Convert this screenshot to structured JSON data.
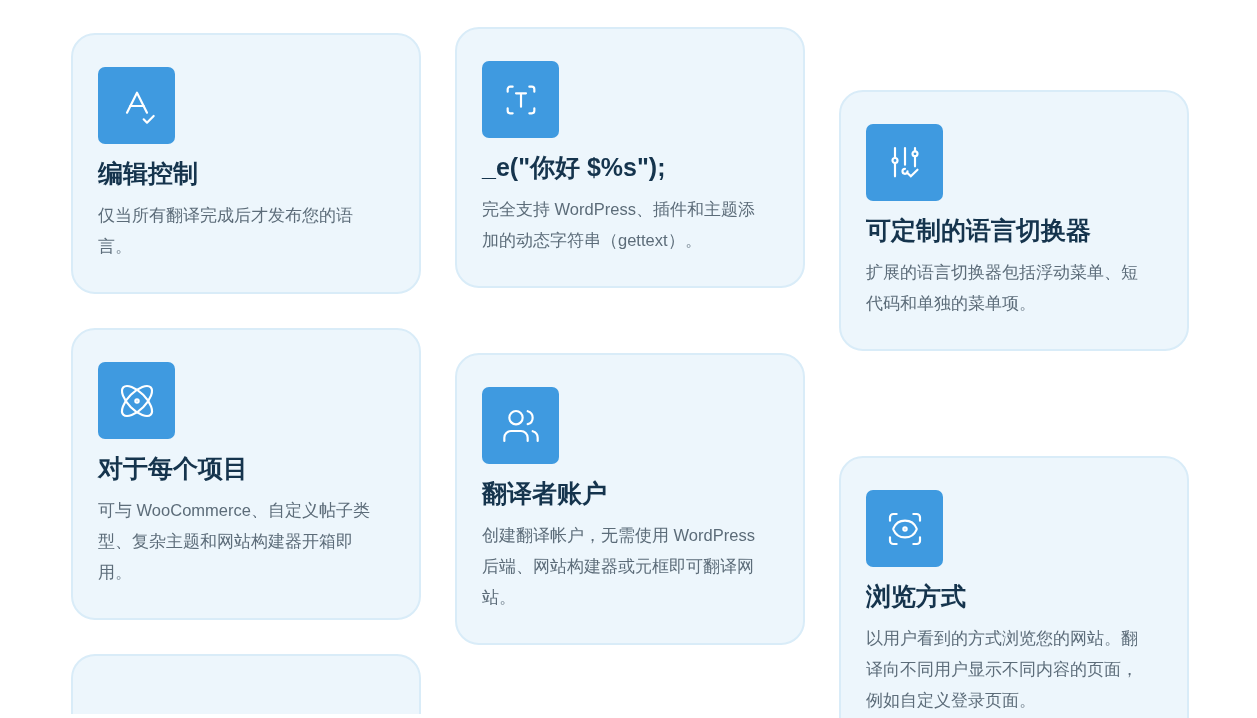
{
  "columns": [
    {
      "cards": [
        {
          "title": "编辑控制",
          "description": "仅当所有翻译完成后才发布您的语言。"
        },
        {
          "title": "对于每个项目",
          "description": "可与 WooCommerce、自定义帖子类型、复杂主题和网站构建器开箱即用。"
        }
      ]
    },
    {
      "cards": [
        {
          "title": "_e(\"你好 $%s\");",
          "description": "完全支持 WordPress、插件和主题添加的动态字符串（gettext）。"
        },
        {
          "title": "翻译者账户",
          "description": "创建翻译帐户，无需使用 WordPress 后端、网站构建器或元框即可翻译网站。"
        }
      ]
    },
    {
      "cards": [
        {
          "title": "可定制的语言切换器",
          "description": "扩展的语言切换器包括浮动菜单、短代码和单独的菜单项。"
        },
        {
          "title": "浏览方式",
          "description": "以用户看到的方式浏览您的网站。翻译向不同用户显示不同内容的页面，例如自定义登录页面。"
        }
      ]
    }
  ]
}
